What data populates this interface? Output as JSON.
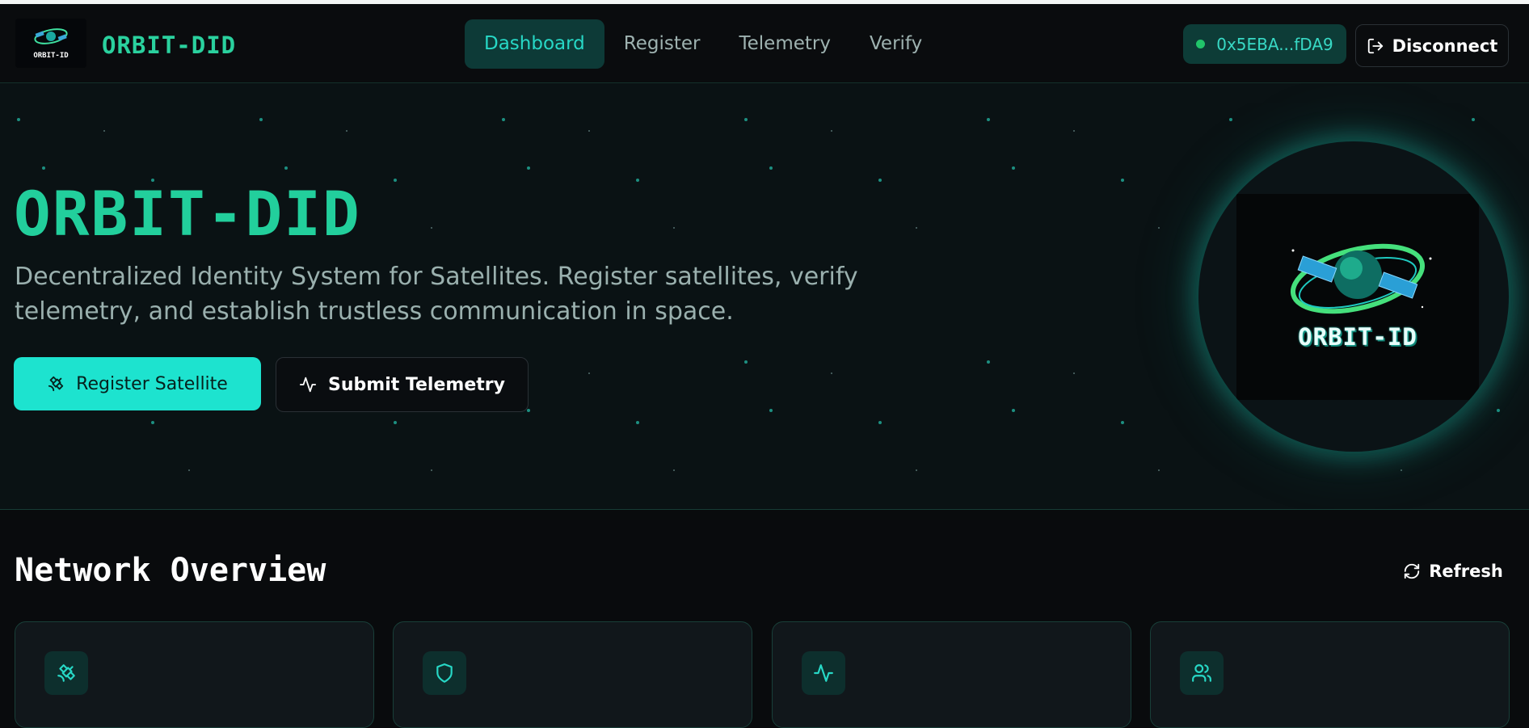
{
  "app": {
    "name": "ORBIT-DID"
  },
  "header": {
    "nav": [
      {
        "label": "Dashboard",
        "active": true
      },
      {
        "label": "Register"
      },
      {
        "label": "Telemetry"
      },
      {
        "label": "Verify"
      }
    ],
    "wallet_address": "0x5EBA...fDA9",
    "disconnect_label": "Disconnect"
  },
  "hero": {
    "title": "ORBIT-DID",
    "subtitle": "Decentralized Identity System for Satellites. Register satellites, verify telemetry, and establish trustless communication in space.",
    "primary_button": "Register Satellite",
    "secondary_button": "Submit Telemetry",
    "logo_text": "ORBIT-ID"
  },
  "overview": {
    "title": "Network Overview",
    "refresh_label": "Refresh",
    "cards": [
      {
        "icon": "satellite-icon"
      },
      {
        "icon": "shield-icon"
      },
      {
        "icon": "activity-icon"
      },
      {
        "icon": "users-icon"
      }
    ]
  },
  "colors": {
    "accent": "#1de3cf",
    "brand": "#22cf9c",
    "background": "#090b0d",
    "hero_background": "#0a1214",
    "wallet_dot": "#21c46a"
  }
}
